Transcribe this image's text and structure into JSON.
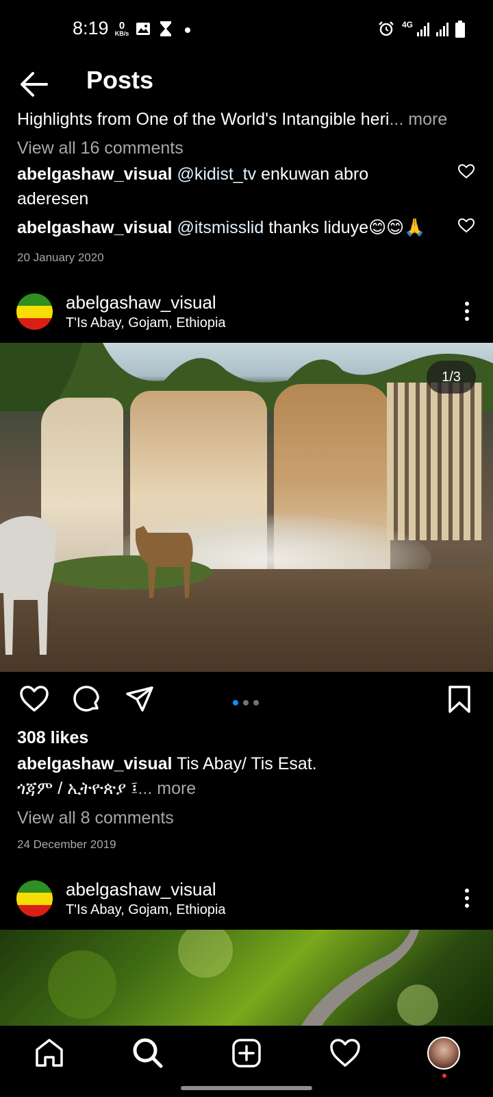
{
  "status_bar": {
    "time": "8:19",
    "net_speed_value": "0",
    "net_speed_unit": "KB/s",
    "network_type": "4G"
  },
  "header": {
    "title": "Posts"
  },
  "prev_post": {
    "caption_truncated": "Highlights from One of the World's Intangible heri",
    "more_label": "... more",
    "view_comments": "View all 16 comments",
    "comments": [
      {
        "user": "abelgashaw_visual",
        "mention": "@kidist_tv",
        "text": " enkuwan abro aderesen"
      },
      {
        "user": "abelgashaw_visual",
        "mention": "@itsmisslid",
        "text": " thanks liduye😊😊🙏"
      }
    ],
    "date": "20 January 2020"
  },
  "post1": {
    "username": "abelgashaw_visual",
    "location": "T'Is Abay, Gojam, Ethiopia",
    "image_counter": "1/3",
    "carousel_active_index": 0,
    "carousel_total": 3,
    "likes": "308 likes",
    "caption_user": "abelgashaw_visual",
    "caption_text": " Tis Abay/ Tis Esat.",
    "caption_line2": "ጎጃም / ኢትዮጵያ ፤",
    "more_label": "... more",
    "view_comments": "View all 8 comments",
    "date": "24 December 2019"
  },
  "post2": {
    "username": "abelgashaw_visual",
    "location": "T'Is Abay, Gojam, Ethiopia"
  },
  "colors": {
    "background": "#000000",
    "secondary_text": "#a8a8a8",
    "mention": "#e0f1ff",
    "active_dot": "#0095f6",
    "notification_dot": "#ff3040"
  },
  "bottom_nav": {
    "items": [
      "home-icon",
      "search-icon",
      "add-post-icon",
      "activity-heart-icon",
      "profile-avatar"
    ]
  }
}
